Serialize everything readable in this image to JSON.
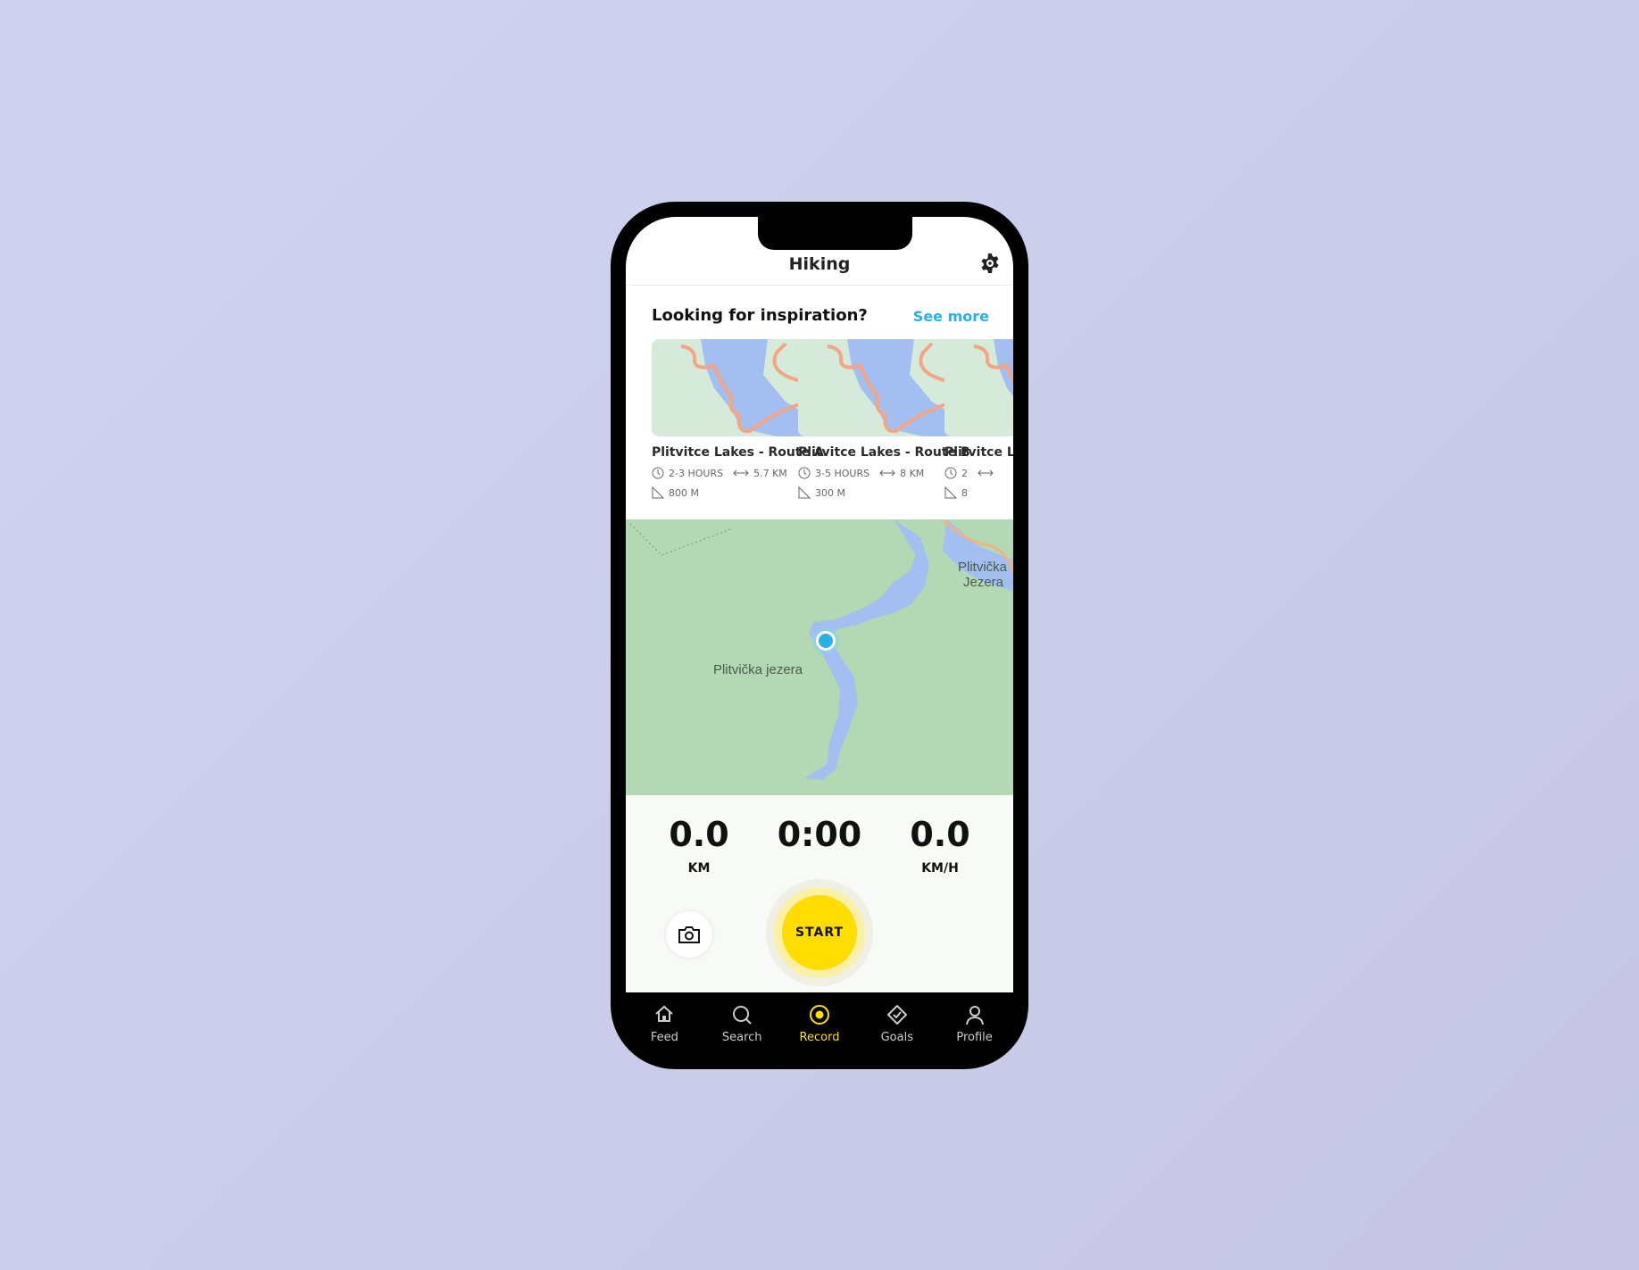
{
  "header": {
    "title": "Hiking",
    "settings_icon": "gear-icon"
  },
  "inspiration": {
    "heading": "Looking for inspiration?",
    "see_more": "See more",
    "routes": [
      {
        "name": "Plitvitce Lakes - Route A",
        "duration": "2-3 HOURS",
        "distance": "5.7 KM",
        "elevation": "800 M"
      },
      {
        "name": "Plitvitce Lakes - Route B",
        "duration": "3-5 HOURS",
        "distance": "8 KM",
        "elevation": "300 M"
      },
      {
        "name": "Plitvitce Lakes",
        "duration": "2",
        "distance": "",
        "elevation": "8"
      }
    ]
  },
  "map": {
    "labels": [
      "Plitvička jezera",
      "Plitvička",
      "Jezera"
    ]
  },
  "stats": {
    "distance": {
      "value": "0.0",
      "unit": "KM"
    },
    "time": {
      "value": "0:00"
    },
    "speed": {
      "value": "0.0",
      "unit": "KM/H"
    }
  },
  "start_label": "START",
  "nav": [
    {
      "label": "Feed",
      "icon": "home-icon"
    },
    {
      "label": "Search",
      "icon": "search-icon"
    },
    {
      "label": "Record",
      "icon": "record-icon",
      "active": true
    },
    {
      "label": "Goals",
      "icon": "goals-icon"
    },
    {
      "label": "Profile",
      "icon": "profile-icon"
    }
  ],
  "colors": {
    "accent": "#ffdd00",
    "link": "#2ab0e4",
    "map_green": "#b2d8b4",
    "water": "#a3bff2",
    "route": "#f4a583"
  }
}
